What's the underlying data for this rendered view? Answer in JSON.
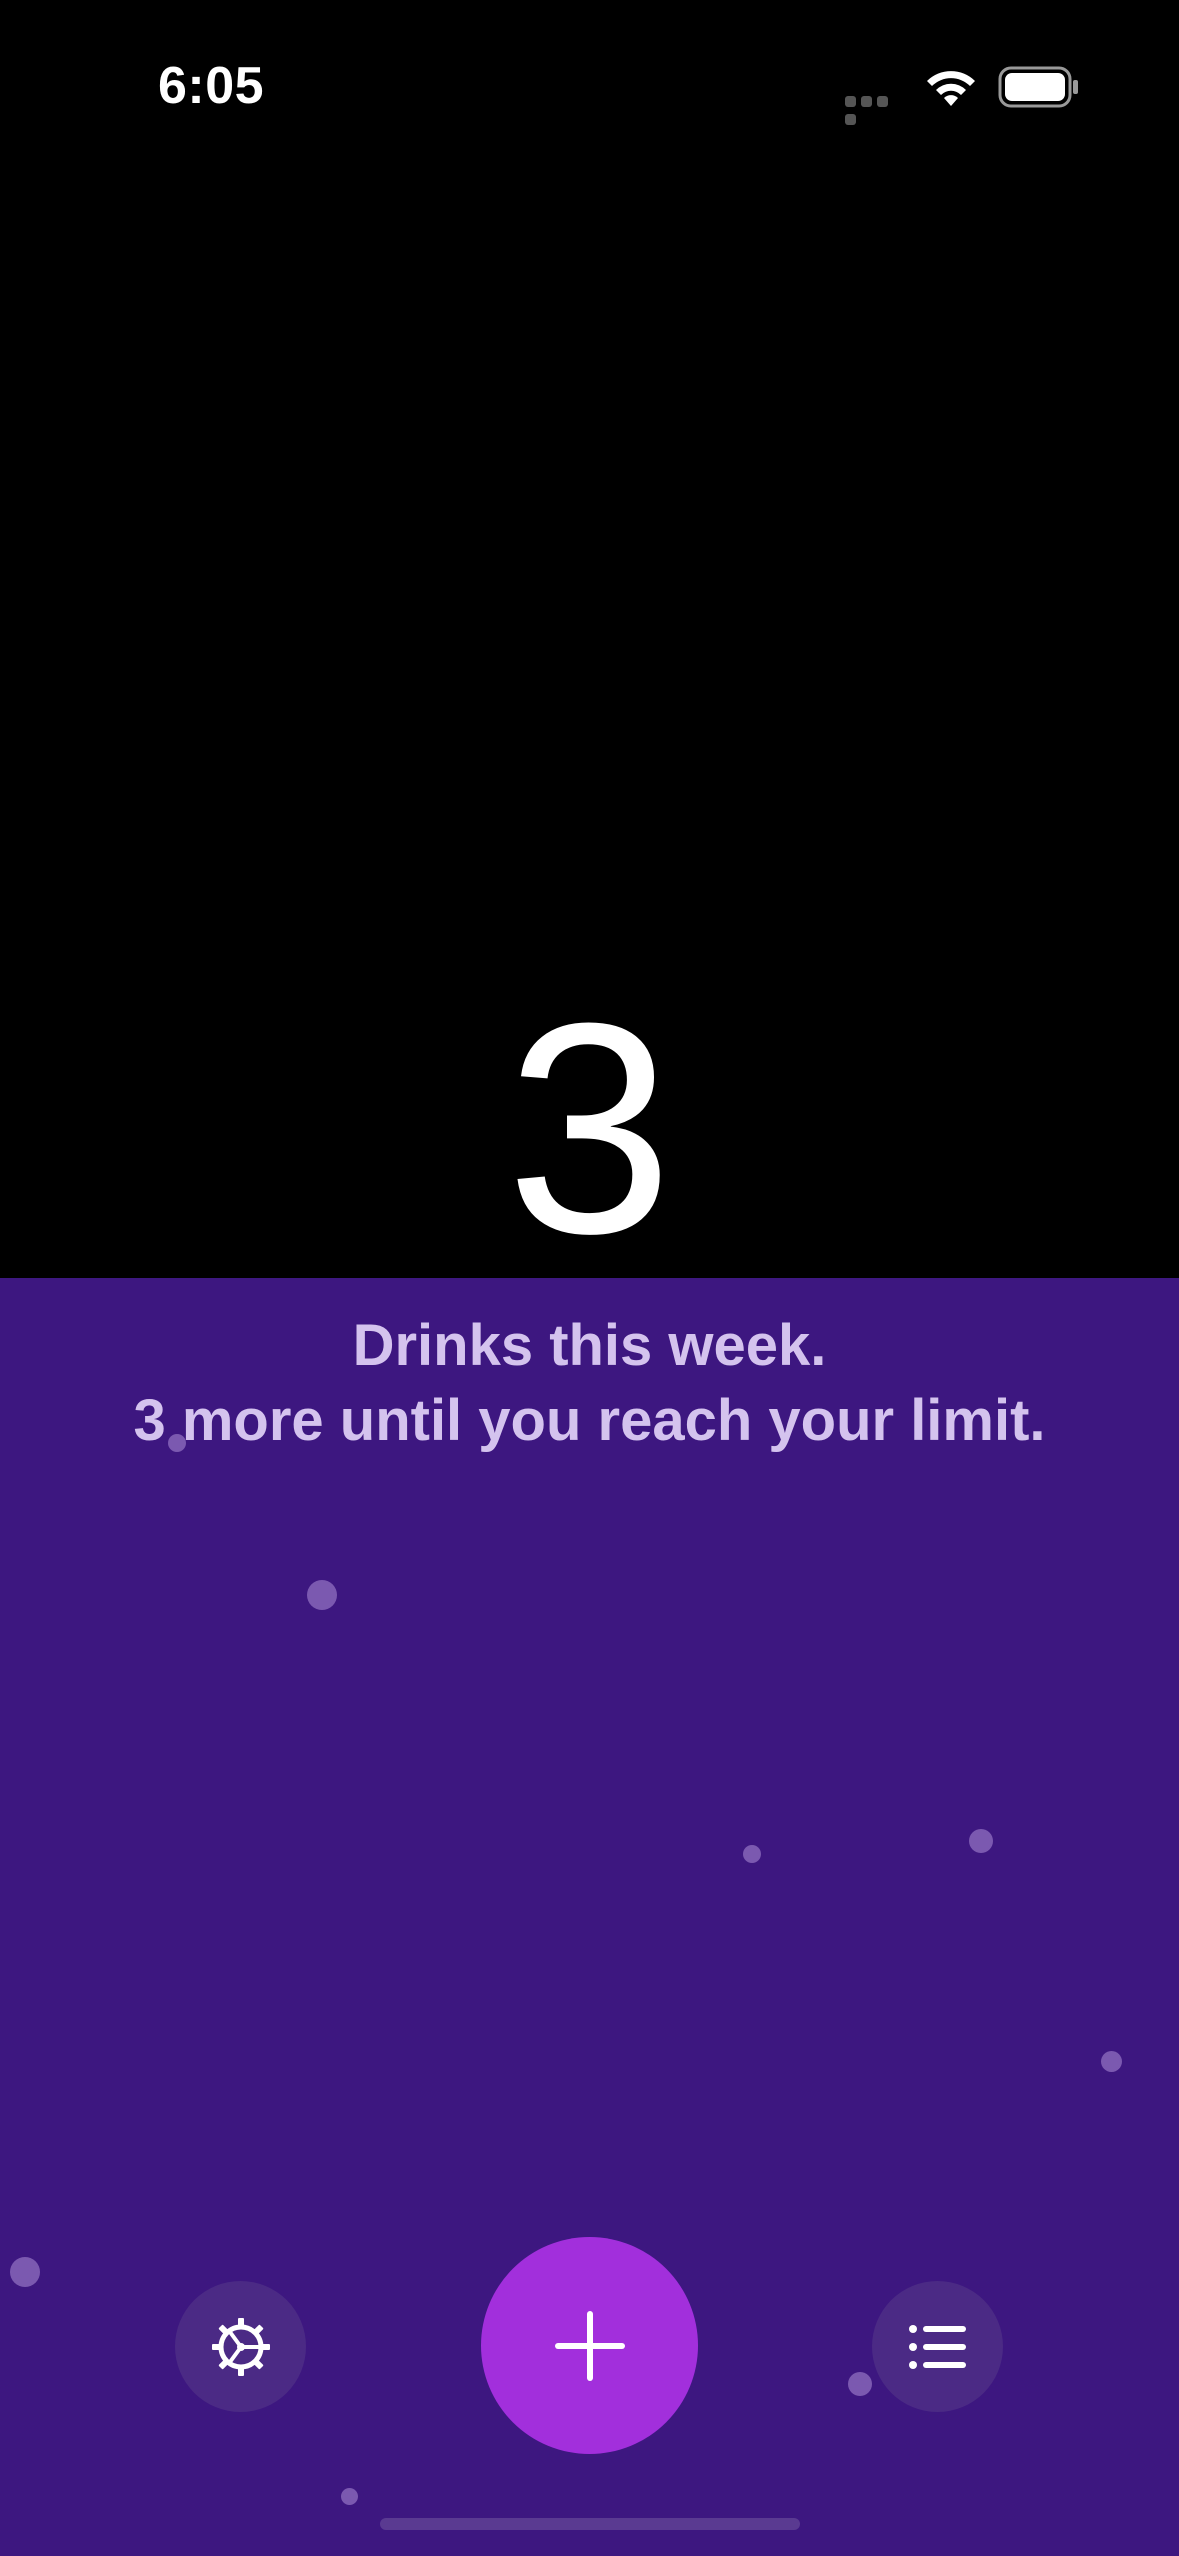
{
  "status_bar": {
    "time": "6:05"
  },
  "counter": {
    "value": "3"
  },
  "message": {
    "line1": "Drinks this week.",
    "line2": "3 more until you reach your limit."
  },
  "toolbar": {
    "settings_icon": "gear-icon",
    "add_icon": "plus-icon",
    "list_icon": "list-icon"
  },
  "colors": {
    "top_background": "#000000",
    "bottom_background": "#3d1780",
    "accent": "#a22fdc",
    "message_text": "#d4c3ee"
  }
}
